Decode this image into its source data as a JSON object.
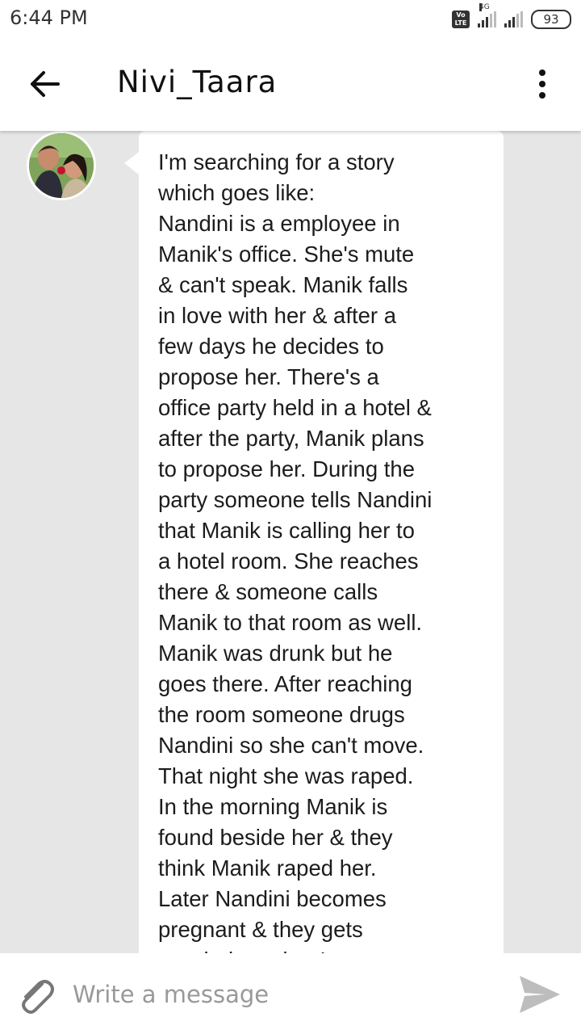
{
  "status_bar": {
    "time": "6:44 PM",
    "volte_label": "Vo LTE",
    "network_label": "4G",
    "battery": "93"
  },
  "header": {
    "title": "Nivi_Taara",
    "back_icon": "arrow-left-icon",
    "menu_icon": "more-vertical-icon"
  },
  "message": {
    "text": "I'm searching for a story\nwhich goes like:\nNandini is a employee in\nManik's office. She's mute\n& can't speak. Manik falls\nin love with her & after a\nfew days he decides to\npropose her. There's a\noffice party held in a hotel &\nafter the party, Manik plans\nto propose her. During the\nparty someone tells Nandini\nthat Manik is calling her to\na hotel room. She reaches\nthere & someone calls\nManik to that room as well.\nManik was drunk but he\ngoes there. After reaching\nthe room someone drugs\nNandini so she can't move.\nThat night she was raped.\nIn the morning Manik is\nfound beside her & they\nthink Manik raped her.\nLater Nandini becomes\npregnant & they gets\nmarried . . . that I"
  },
  "composer": {
    "placeholder": "Write a message",
    "attach_icon": "paperclip-icon",
    "send_icon": "send-icon"
  },
  "colors": {
    "background": "#e6e6e6",
    "bubble": "#ffffff",
    "text": "#1c1c1c",
    "placeholder": "#999999",
    "send_icon": "#bdbdbd"
  }
}
